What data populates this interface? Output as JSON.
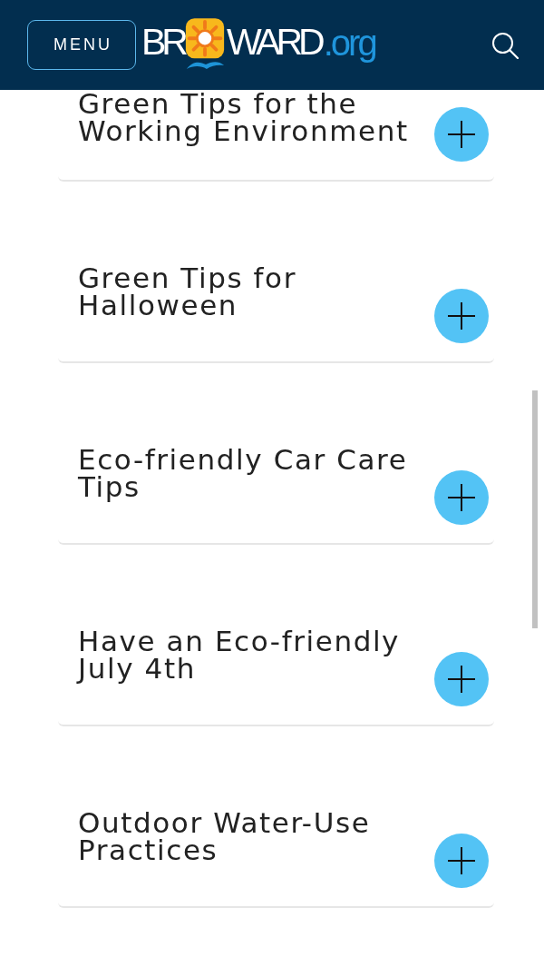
{
  "header": {
    "menu_button": "MENU",
    "logo": {
      "text_before": "BR",
      "text_after": "WARD",
      "domain": ".org"
    }
  },
  "accordion": [
    {
      "title": "Green Tips for the Working Environment",
      "expanded": false
    },
    {
      "title": "Green Tips for Halloween",
      "expanded": false
    },
    {
      "title": "Eco-friendly Car Care Tips",
      "expanded": false
    },
    {
      "title": "Have an Eco-friendly July 4th",
      "expanded": false
    },
    {
      "title": "Outdoor Water-Use Practices",
      "expanded": false
    }
  ]
}
